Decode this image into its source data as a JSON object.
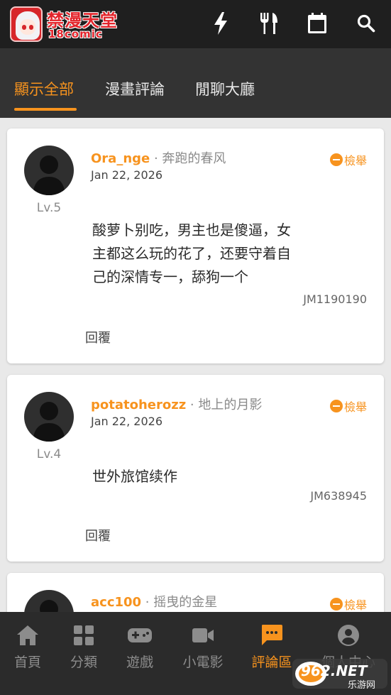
{
  "header": {
    "logo_title": "禁漫天堂",
    "logo_sub": "18comic"
  },
  "tabs": [
    {
      "label": "顯示全部",
      "active": true
    },
    {
      "label": "漫畫評論",
      "active": false
    },
    {
      "label": "閒聊大廳",
      "active": false
    }
  ],
  "comments": [
    {
      "username": "Ora_nge",
      "title": " · 奔跑的春风",
      "date": "Jan 22, 2026",
      "level": "Lv.5",
      "report": "檢舉",
      "lines": [
        "酸萝卜别吃，男主也是傻逼，女",
        "主都这么玩的花了，还要守着自",
        "己的深情专一，舔狗一个"
      ],
      "comic_id": "JM1190190",
      "reply": "回覆"
    },
    {
      "username": "potatoherozz",
      "title": " · 地上的月影",
      "date": "Jan 22, 2026",
      "level": "Lv.4",
      "report": "檢舉",
      "lines": [
        "世外旅馆续作"
      ],
      "comic_id": "JM638945",
      "reply": "回覆"
    },
    {
      "username": "acc100",
      "title": " · 摇曳的金星",
      "report": "檢舉"
    }
  ],
  "bottom_nav": [
    {
      "label": "首頁",
      "icon": "home-icon",
      "active": false
    },
    {
      "label": "分類",
      "icon": "grid-icon",
      "active": false
    },
    {
      "label": "遊戲",
      "icon": "gamepad-icon",
      "active": false
    },
    {
      "label": "小電影",
      "icon": "video-icon",
      "active": false
    },
    {
      "label": "評論區",
      "icon": "comment-icon",
      "active": true
    },
    {
      "label": "個人中心",
      "icon": "account-icon",
      "active": false
    }
  ],
  "watermark": {
    "brand": "962.NET",
    "sub": "乐游网"
  },
  "colors": {
    "accent": "#f7931e",
    "topbar": "#1f1f1f",
    "tabbar": "#333333",
    "navbar": "#2b2b2b"
  }
}
